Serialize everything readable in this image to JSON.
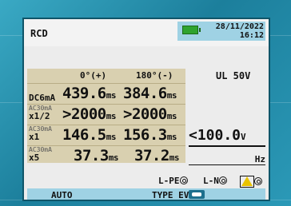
{
  "screen": {
    "title": "RCD",
    "date": "28/11/2022",
    "time": "16:12"
  },
  "table": {
    "col1_header": "0°(+)",
    "col2_header": "180°(-)",
    "unit": "ms",
    "rows": [
      {
        "label_small": "",
        "label_main": "DC6mA",
        "val1": "439.6",
        "val2": "384.6"
      },
      {
        "label_small": "AC30mA",
        "label_main": "x1/2",
        "val1": ">2000",
        "val2": ">2000"
      },
      {
        "label_small": "AC30mA",
        "label_main": "x1",
        "val1": "146.5",
        "val2": "156.3"
      },
      {
        "label_small": "AC30mA",
        "label_main": "x5",
        "val1": "37.3",
        "val2": "37.2"
      }
    ]
  },
  "right": {
    "ul": "UL 50V",
    "limit_value": "<100.0",
    "limit_unit": "V",
    "hz_label": "Hz"
  },
  "indicators": {
    "lpe": "L-PE",
    "ln": "L-N"
  },
  "bottom": {
    "mode": "AUTO",
    "type_label": "TYPE EV"
  },
  "colors": {
    "screen_bg": "#ececec",
    "panel_bg": "#d9d0b0",
    "status_bar": "#9fd2e4",
    "bezel": "#1f8aa6"
  }
}
